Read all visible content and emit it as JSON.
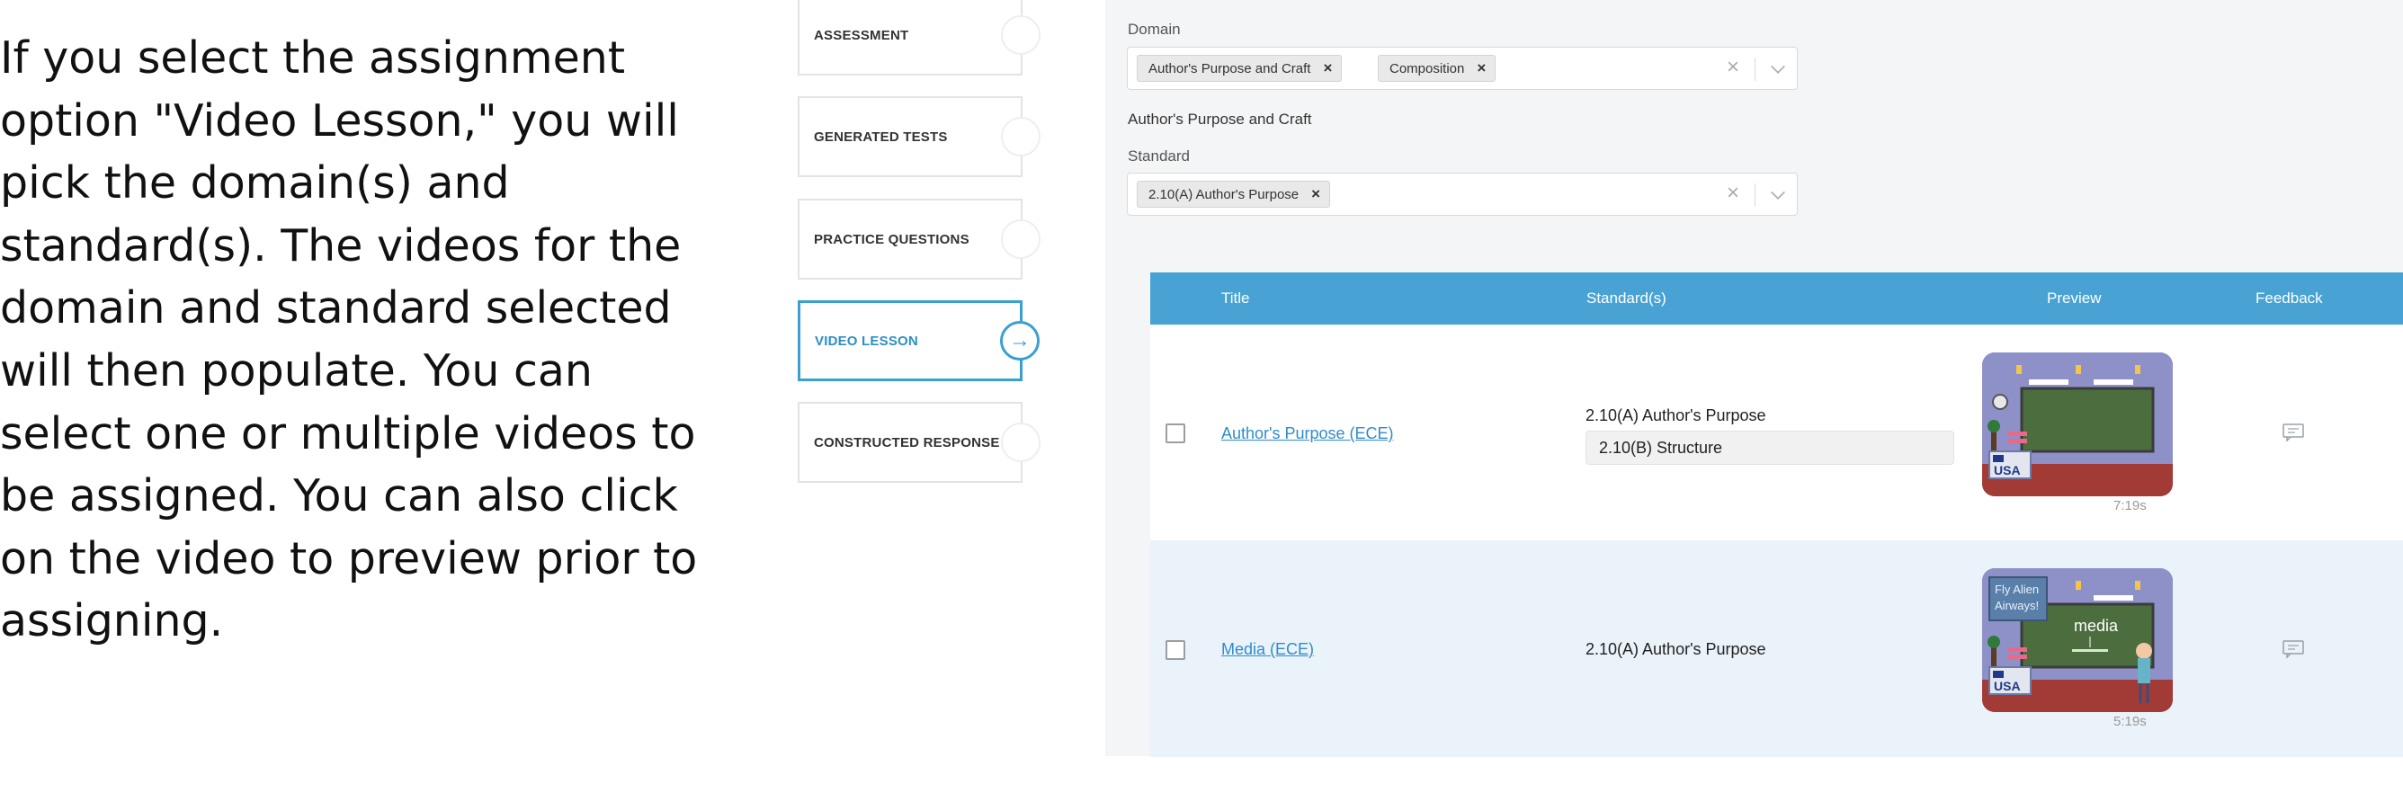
{
  "instructions": {
    "lines": [
      "If you select the assignment",
      "option \"Video Lesson,\" you will",
      "pick the domain(s) and",
      "standard(s). The videos for the",
      "domain and standard selected",
      "will then populate. You can",
      "select one or multiple videos to",
      "be assigned. You can also click",
      "on the video to preview prior to",
      "assigning."
    ]
  },
  "steps": [
    {
      "label": "ASSESSMENT",
      "active": false
    },
    {
      "label": "GENERATED TESTS",
      "active": false
    },
    {
      "label": "PRACTICE QUESTIONS",
      "active": false
    },
    {
      "label": "VIDEO LESSON",
      "active": true
    },
    {
      "label": "CONSTRUCTED RESPONSE",
      "active": false
    }
  ],
  "form": {
    "domain_label": "Domain",
    "domain_chips": [
      "Author's Purpose and Craft",
      "Composition"
    ],
    "domain_heading": "Author's Purpose and Craft",
    "standard_label": "Standard",
    "standard_chips": [
      "2.10(A) Author's Purpose"
    ]
  },
  "table": {
    "headers": {
      "title": "Title",
      "standards": "Standard(s)",
      "preview": "Preview",
      "feedback": "Feedback"
    },
    "rows": [
      {
        "title": "Author's Purpose (ECE)",
        "standards": [
          "2.10(A) Author's Purpose",
          "2.10(B) Structure"
        ],
        "duration": "7:19s",
        "thumb_badge": "USA"
      },
      {
        "title": "Media (ECE)",
        "standards": [
          "2.10(A) Author's Purpose"
        ],
        "duration": "5:19s",
        "thumb_badge": "USA",
        "thumb_sign": [
          "Fly Alien",
          "Airways!"
        ],
        "thumb_board": "media"
      }
    ]
  },
  "colors": {
    "accent": "#48a3d4",
    "link": "#2f8ccc",
    "panel_bg": "#f4f5f6",
    "row_alt": "#eaf3fa"
  }
}
